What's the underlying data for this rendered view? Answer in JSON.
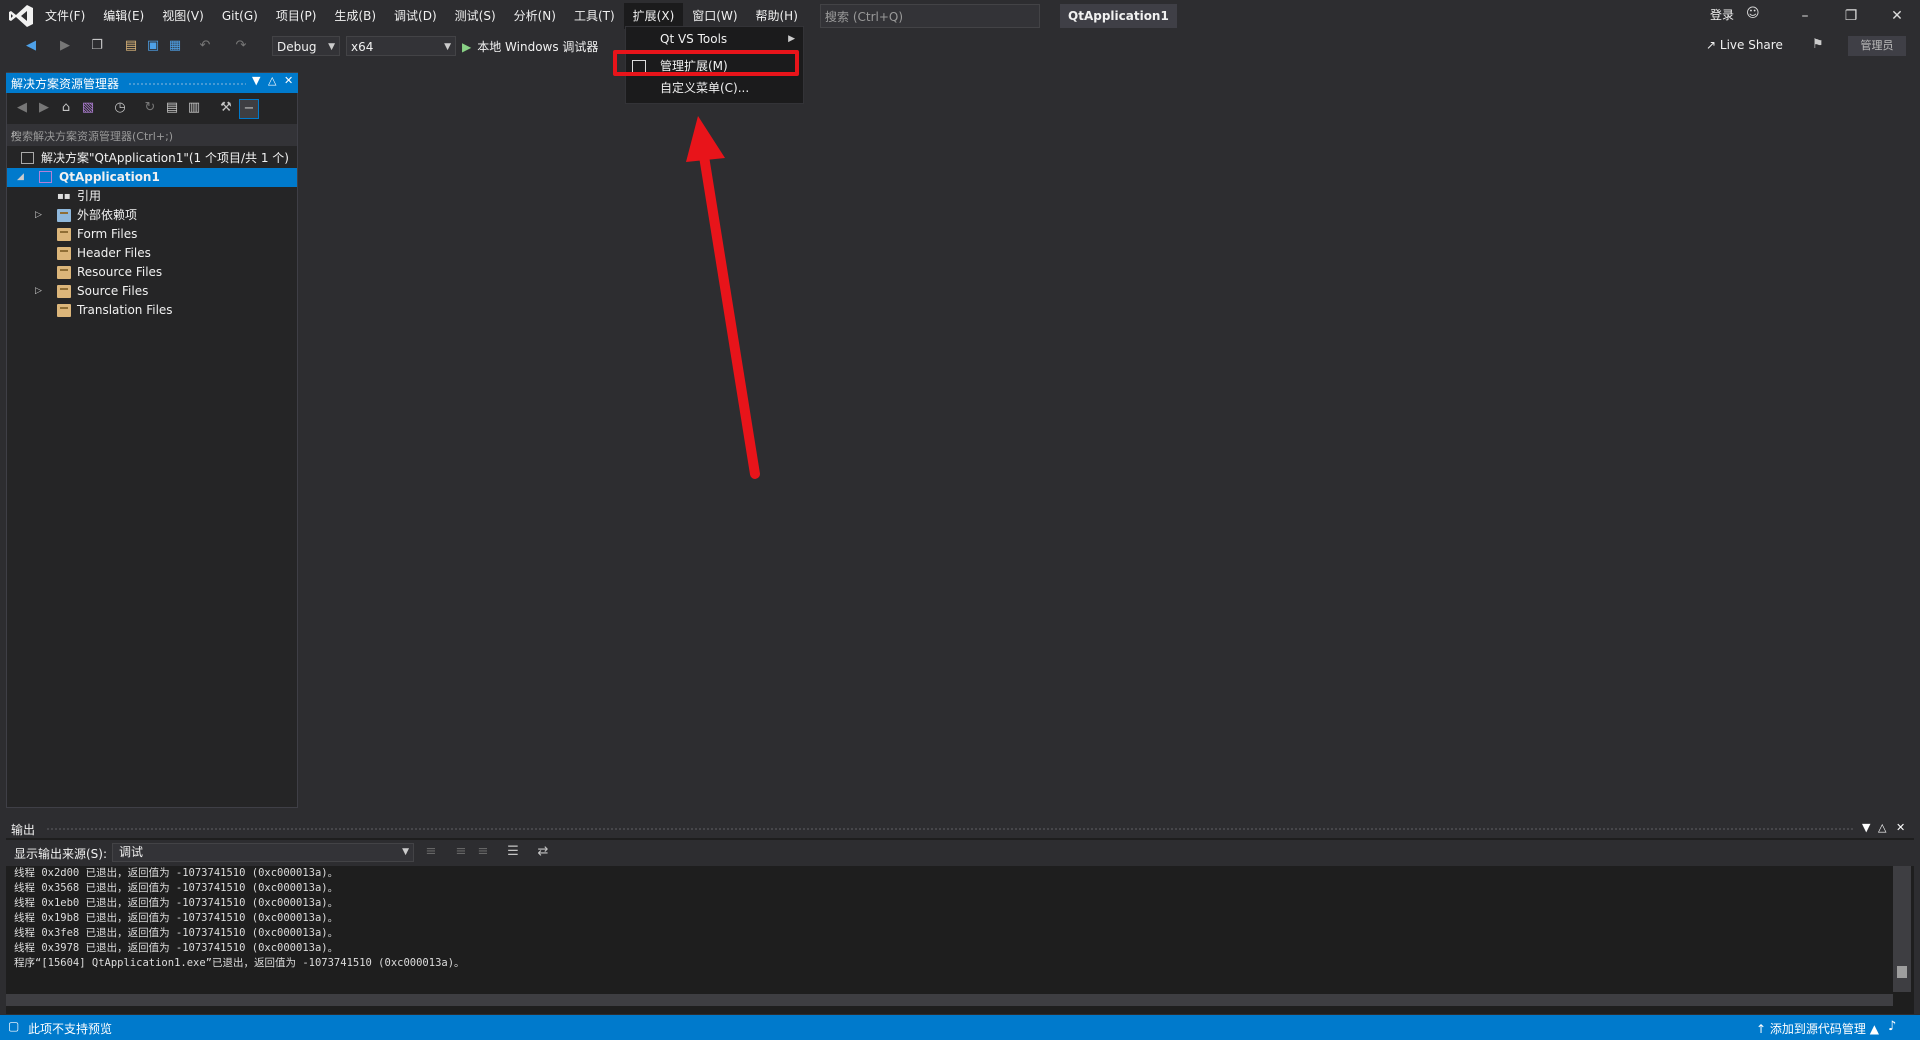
{
  "menu": {
    "items": [
      "文件(F)",
      "编辑(E)",
      "视图(V)",
      "Git(G)",
      "项目(P)",
      "生成(B)",
      "调试(D)",
      "测试(S)",
      "分析(N)",
      "工具(T)",
      "扩展(X)",
      "窗口(W)",
      "帮助(H)"
    ],
    "search_placeholder": "搜索 (Ctrl+Q)",
    "solution_title": "QtApplication1",
    "login": "登录"
  },
  "toolbar": {
    "config": "Debug",
    "platform": "x64",
    "run_label": "本地 Windows 调试器",
    "live_share": "Live Share",
    "admin": "管理员"
  },
  "extensions_menu": {
    "items": [
      "Qt VS Tools",
      "管理扩展(M)",
      "自定义菜单(C)..."
    ],
    "highlighted": "管理扩展(M)"
  },
  "solution_explorer": {
    "title": "解决方案资源管理器",
    "search_placeholder": "搜索解决方案资源管理器(Ctrl+;)",
    "solution_node": "解决方案\"QtApplication1\"(1 个项目/共 1 个)",
    "project": "QtApplication1",
    "children": [
      "引用",
      "外部依赖项",
      "Form Files",
      "Header Files",
      "Resource Files",
      "Source Files",
      "Translation Files"
    ]
  },
  "output": {
    "title": "输出",
    "source_label": "显示输出来源(S):",
    "source_value": "调试",
    "lines": [
      "线程 0x2d00 已退出，返回值为 -1073741510 (0xc000013a)。",
      "线程 0x3568 已退出，返回值为 -1073741510 (0xc000013a)。",
      "线程 0x1eb0 已退出，返回值为 -1073741510 (0xc000013a)。",
      "线程 0x19b8 已退出，返回值为 -1073741510 (0xc000013a)。",
      "线程 0x3fe8 已退出，返回值为 -1073741510 (0xc000013a)。",
      "线程 0x3978 已退出，返回值为 -1073741510 (0xc000013a)。",
      "程序“[15604] QtApplication1.exe”已退出，返回值为 -1073741510 (0xc000013a)。"
    ]
  },
  "statusbar": {
    "left": "此项不支持预览",
    "right": "添加到源代码管理"
  },
  "colors": {
    "accent": "#007acc",
    "annotation": "#e8141a",
    "background": "#2d2d30"
  }
}
